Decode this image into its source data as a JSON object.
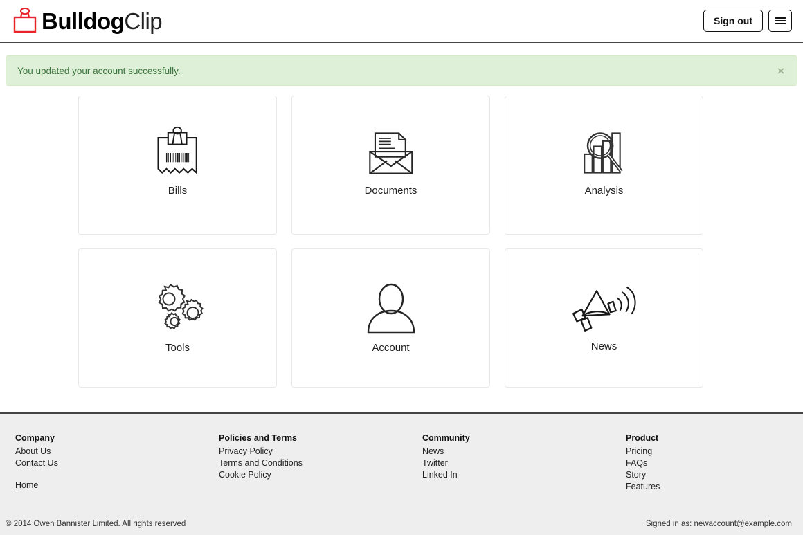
{
  "header": {
    "brand": {
      "icon": "bulldog-clip-icon",
      "bold_text": "Bulldog",
      "light_text": "Clip",
      "icon_color": "#e8232a"
    },
    "sign_out_label": "Sign out",
    "menu_icon": "hamburger-menu-icon"
  },
  "alert": {
    "message": "You updated your account successfully.",
    "close_label": "×",
    "background": "#dff0d8",
    "text_color": "#3c763d"
  },
  "tiles": [
    {
      "label": "Bills",
      "icon": "receipt-barcode-clip-icon"
    },
    {
      "label": "Documents",
      "icon": "envelope-document-icon"
    },
    {
      "label": "Analysis",
      "icon": "bar-chart-magnifier-icon"
    },
    {
      "label": "Tools",
      "icon": "gears-icon"
    },
    {
      "label": "Account",
      "icon": "person-icon"
    },
    {
      "label": "News",
      "icon": "megaphone-icon"
    }
  ],
  "footer": {
    "columns": [
      {
        "heading": "Company",
        "links": [
          "About Us",
          "Contact Us"
        ],
        "extra_links": [
          "Home"
        ]
      },
      {
        "heading": "Policies and Terms",
        "links": [
          "Privacy Policy",
          "Terms and Conditions",
          "Cookie Policy"
        ],
        "extra_links": []
      },
      {
        "heading": "Community",
        "links": [
          "News",
          "Twitter",
          "Linked In"
        ],
        "extra_links": []
      },
      {
        "heading": "Product",
        "links": [
          "Pricing",
          "FAQs",
          "Story",
          "Features"
        ],
        "extra_links": []
      }
    ],
    "copyright": "© 2014 Owen Bannister Limited. All rights reserved",
    "signed_in_as": "Signed in as: newaccount@example.com",
    "background": "#eeeeee"
  }
}
